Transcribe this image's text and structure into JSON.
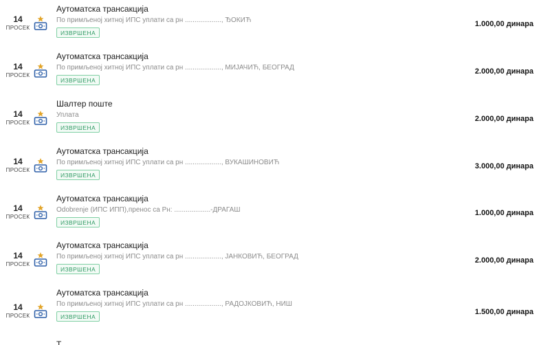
{
  "transactions": [
    {
      "date_day": "14",
      "date_month": "ПРОСЕК",
      "icon": "payment-slip-icon",
      "title": "Аутоматска трансакција",
      "description": "По примљеној хитној ИПС уплати са рн ..................., ЂОКИЋ",
      "status": "ИЗВРШЕНА",
      "amount": "1.000,00 динара"
    },
    {
      "date_day": "14",
      "date_month": "ПРОСЕК",
      "icon": "payment-slip-icon",
      "title": "Аутоматска трансакција",
      "description": "По примљеној хитној ИПС уплати са рн ..................., МИЈАЧИЋ, БЕОГРАД",
      "status": "ИЗВРШЕНА",
      "amount": "2.000,00 динара"
    },
    {
      "date_day": "14",
      "date_month": "ПРОСЕК",
      "icon": "payment-slip-icon",
      "title": "Шалтер поште",
      "description": "Уплата",
      "status": "ИЗВРШЕНА",
      "amount": "2.000,00 динара"
    },
    {
      "date_day": "14",
      "date_month": "ПРОСЕК",
      "icon": "payment-slip-icon",
      "title": "Аутоматска трансакција",
      "description": "По примљеној хитној ИПС уплати са рн ..................., ВУКАШИНОВИЋ",
      "status": "ИЗВРШЕНА",
      "amount": "3.000,00 динара"
    },
    {
      "date_day": "14",
      "date_month": "ПРОСЕК",
      "icon": "payment-slip-icon",
      "title": "Аутоматска трансакција",
      "description": "Odobrenje (ИПС ИПП),пренос са Рн: ...................-ДРАГАШ",
      "status": "ИЗВРШЕНА",
      "amount": "1.000,00 динара"
    },
    {
      "date_day": "14",
      "date_month": "ПРОСЕК",
      "icon": "payment-slip-icon",
      "title": "Аутоматска трансакција",
      "description": "По примљеној хитној ИПС уплати са рн ..................., ЈАНКОВИЋ, БЕОГРАД",
      "status": "ИЗВРШЕНА",
      "amount": "2.000,00 динара"
    },
    {
      "date_day": "14",
      "date_month": "ПРОСЕК",
      "icon": "payment-slip-icon",
      "title": "Аутоматска трансакција",
      "description": "По примљеној хитној ИПС уплати са рн ..................., РАДОЈКОВИЋ, НИШ",
      "status": "ИЗВРШЕНА",
      "amount": "1.500,00 динара"
    }
  ],
  "partial_row_title": "Т..........",
  "colors": {
    "status_text": "#2e9a63",
    "status_border": "#7fcfa3",
    "icon_blue": "#2d5fa8",
    "icon_gold": "#e2a428"
  }
}
